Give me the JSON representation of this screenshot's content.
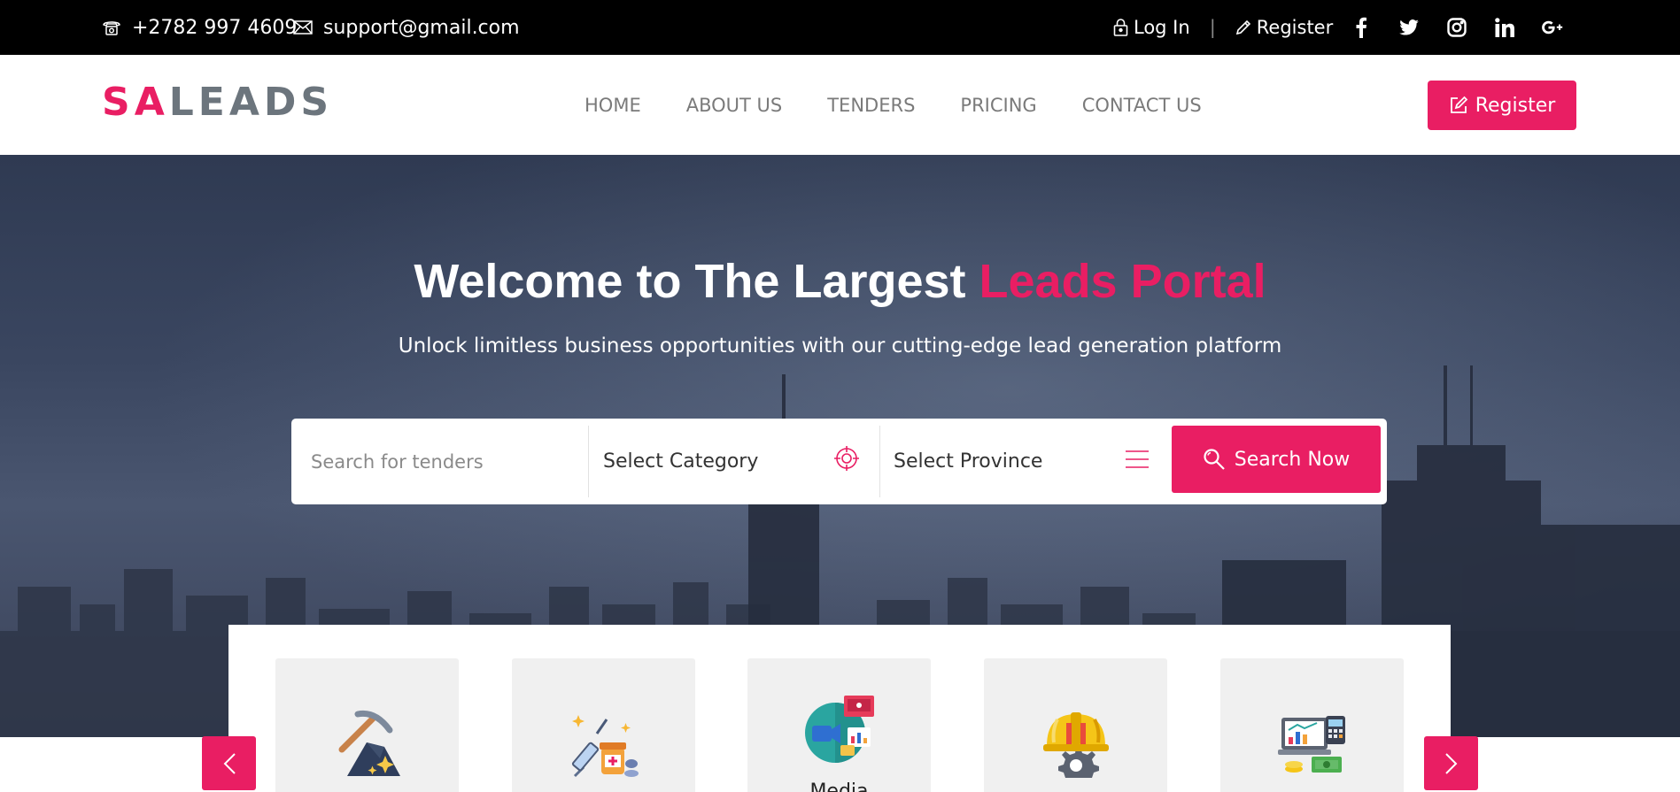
{
  "topbar": {
    "phone": "+2782 997 4609",
    "email": "support@gmail.com",
    "login_label": "Log In",
    "separator": "|",
    "register_label": "Register",
    "social_icons": [
      "facebook-icon",
      "twitter-icon",
      "instagram-icon",
      "linkedin-icon",
      "google-plus-icon"
    ]
  },
  "header": {
    "logo_part1": "SA",
    "logo_part2": "LEADS",
    "nav": [
      "HOME",
      "ABOUT US",
      "TENDERS",
      "PRICING",
      "CONTACT US"
    ],
    "register_button": "Register"
  },
  "hero": {
    "title_main": "Welcome to The Largest ",
    "title_highlight": "Leads Portal",
    "subtitle": "Unlock limitless business opportunities with our cutting-edge lead generation platform"
  },
  "search": {
    "placeholder": "Search for tenders",
    "category_value": "Select Category",
    "province_value": "Select Province",
    "button_label": "Search Now"
  },
  "categories": {
    "items": [
      {
        "icon": "mining-icon",
        "label": ""
      },
      {
        "icon": "medical-icon",
        "label": ""
      },
      {
        "icon": "media-icon",
        "label": "Media"
      },
      {
        "icon": "engineering-icon",
        "label": ""
      },
      {
        "icon": "finance-icon",
        "label": ""
      }
    ]
  },
  "colors": {
    "accent": "#e91e63",
    "topbar_bg": "#000000",
    "logo_gray": "#6c757d",
    "nav_text": "#7a7a7a"
  }
}
